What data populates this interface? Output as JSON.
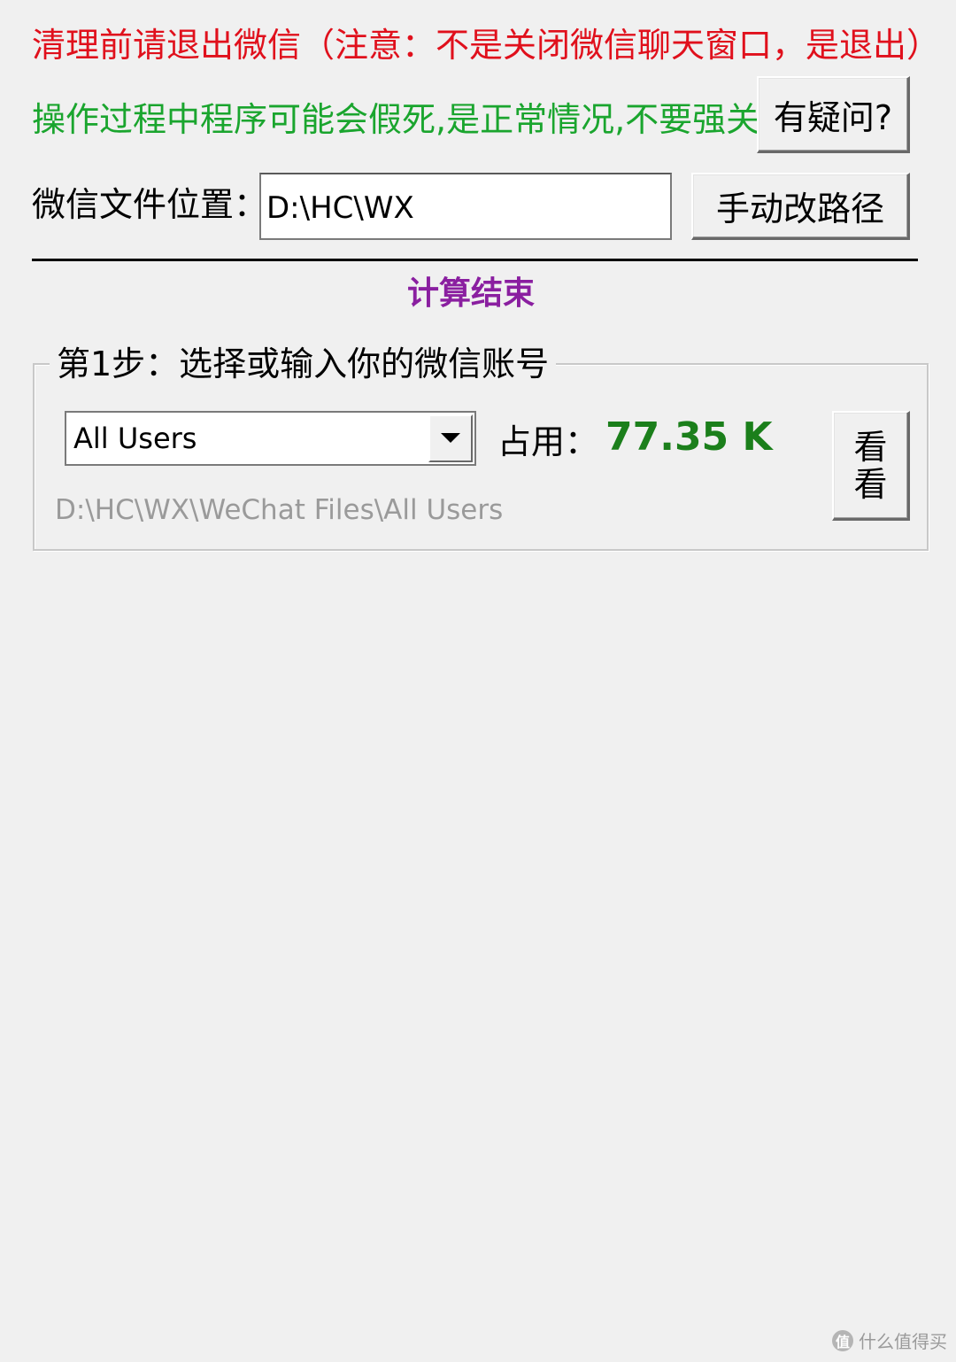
{
  "warnings": {
    "exit_wechat": "清理前请退出微信（注意：不是关闭微信聊天窗口，是退出）",
    "may_freeze": "操作过程中程序可能会假死,是正常情况,不要强关!"
  },
  "buttons": {
    "help": "有疑问?",
    "change_path": "手动改路径",
    "view_line1": "看",
    "view_line2": "看"
  },
  "path": {
    "label": "微信文件位置：",
    "value": "D:\\HC\\WX"
  },
  "status": "计算结束",
  "step1": {
    "legend": "第1步：选择或输入你的微信账号",
    "account_selected": "All Users",
    "usage_label": "占用：",
    "usage_value": "77.35 K",
    "full_path": "D:\\HC\\WX\\WeChat Files\\All Users"
  },
  "watermark": {
    "badge": "值",
    "text": "什么值得买"
  },
  "colors": {
    "warning_red": "#e0101c",
    "warning_green": "#1aa52e",
    "status_purple": "#8a1fa0",
    "usage_green": "#1b7f1b"
  }
}
